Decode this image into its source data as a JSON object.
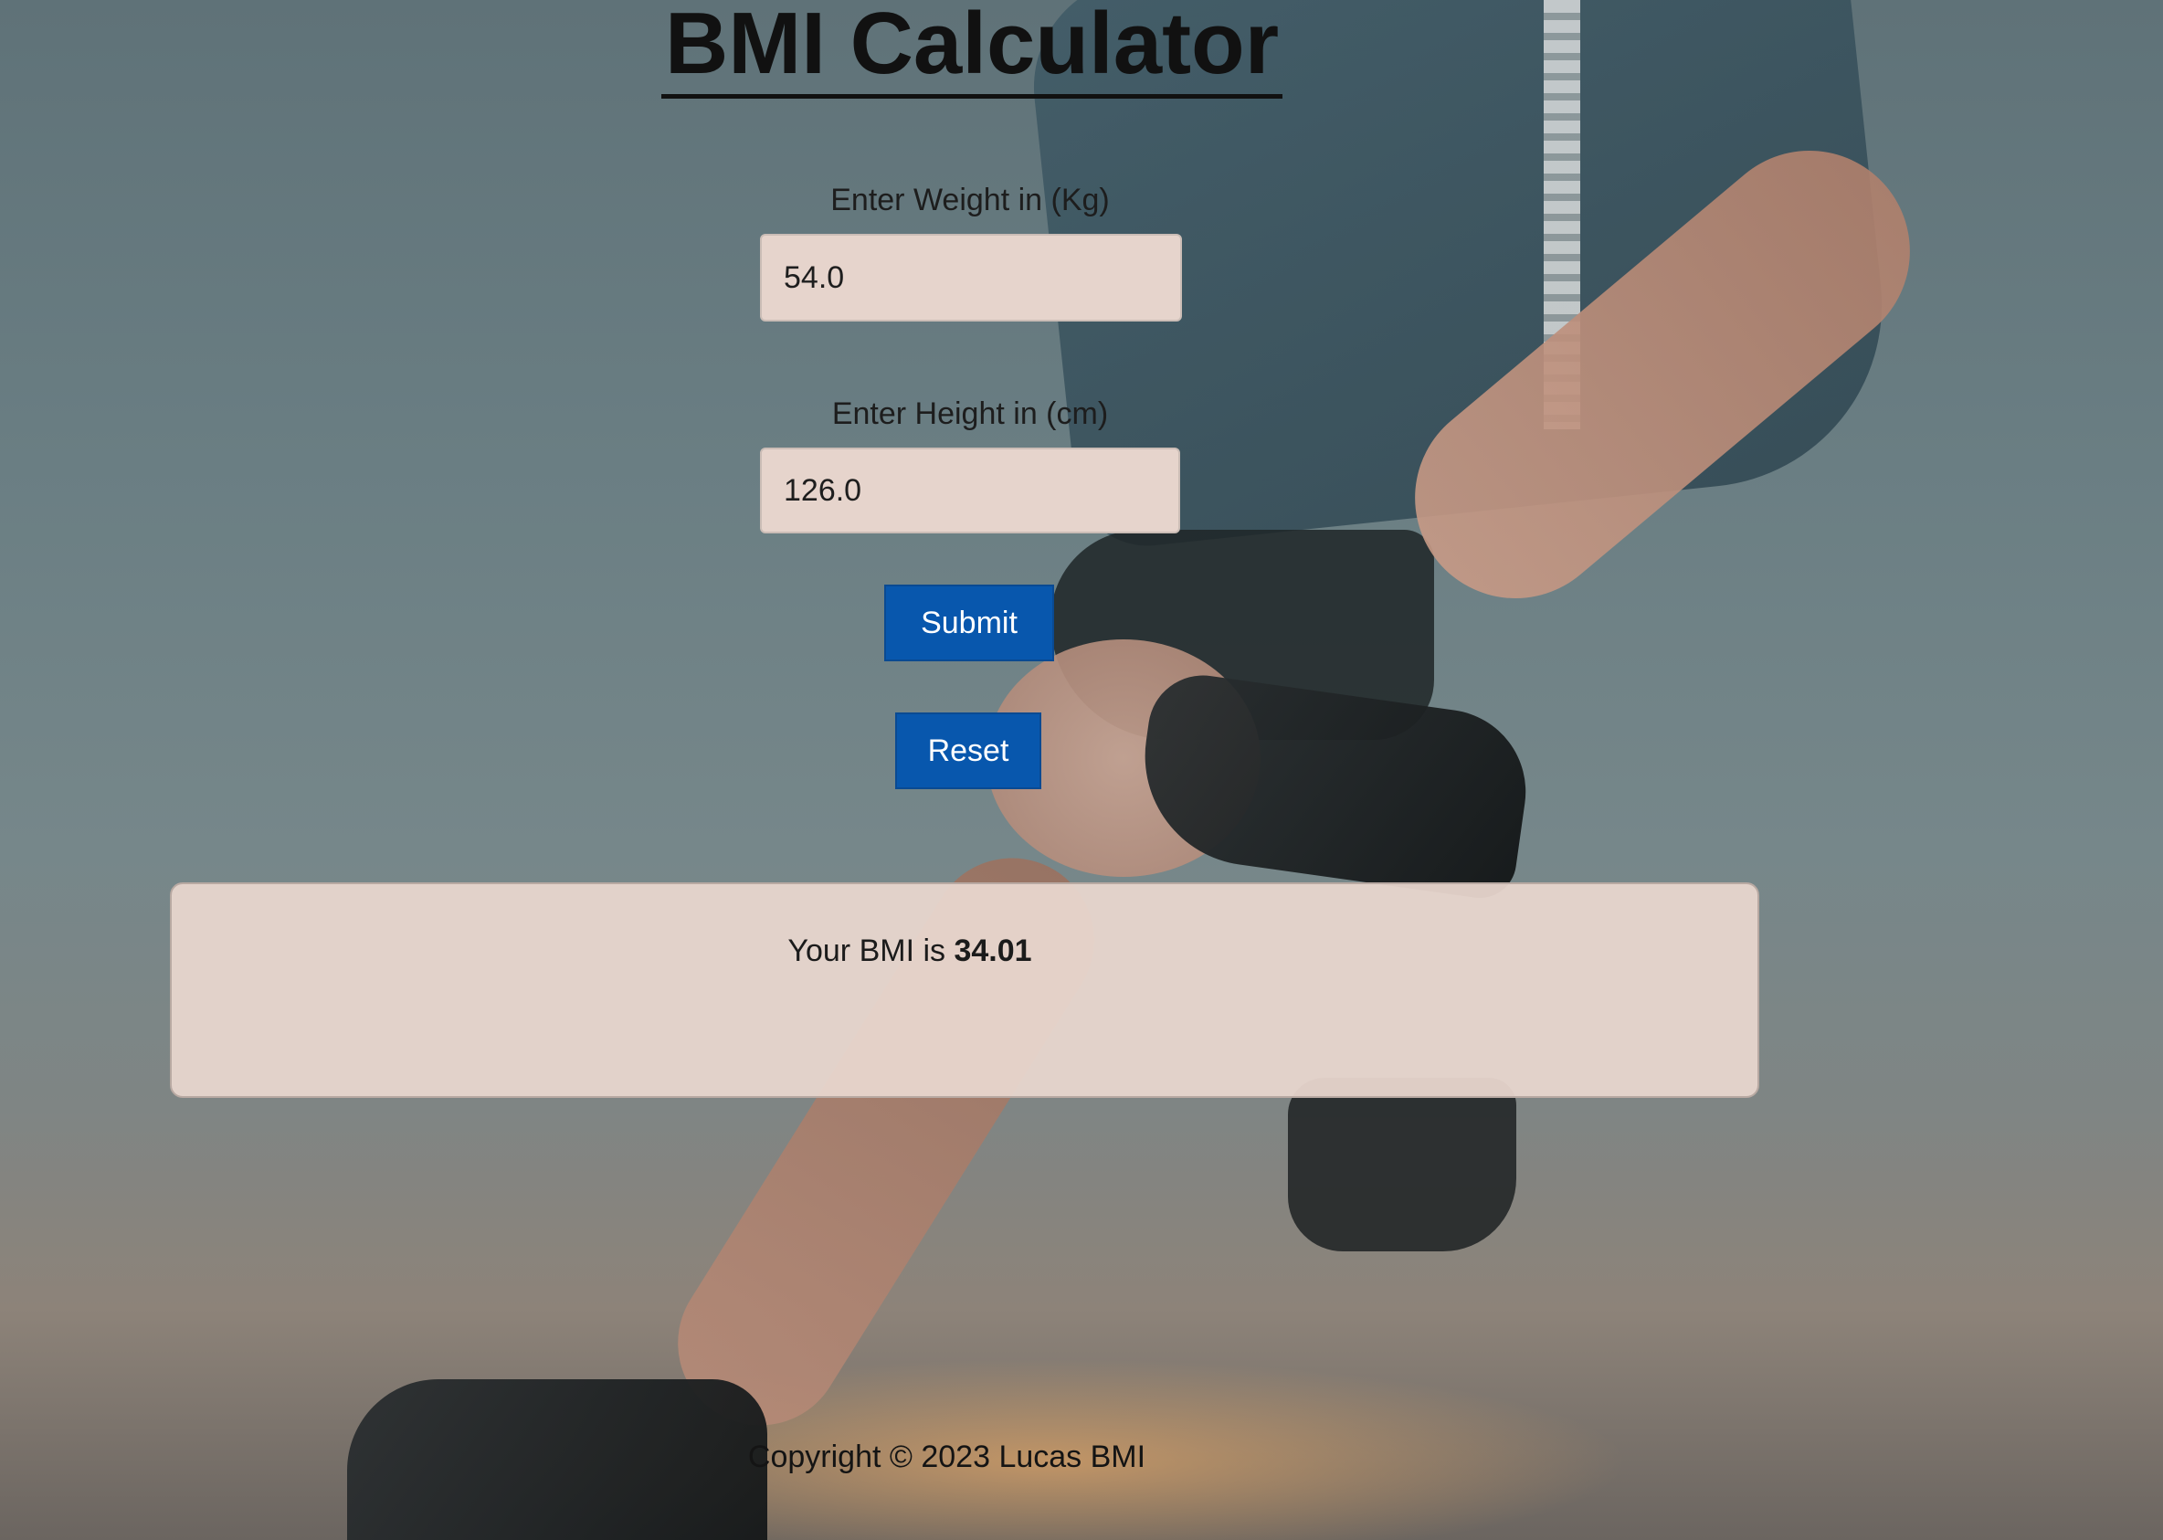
{
  "title": "BMI Calculator",
  "form": {
    "weight_label": "Enter Weight in (Kg)",
    "weight_value": "54.0",
    "height_label": "Enter Height in (cm)",
    "height_value": "126.0",
    "submit_label": "Submit",
    "reset_label": "Reset"
  },
  "result": {
    "prefix": "Your BMI is",
    "value": "34.01"
  },
  "footer": {
    "text": "Copyright © 2023 Lucas BMI"
  },
  "colors": {
    "button": "#0857ad",
    "input_bg": "#e6d4cc",
    "result_bg": "#e8d6ce"
  },
  "background_image": "runner-photo"
}
